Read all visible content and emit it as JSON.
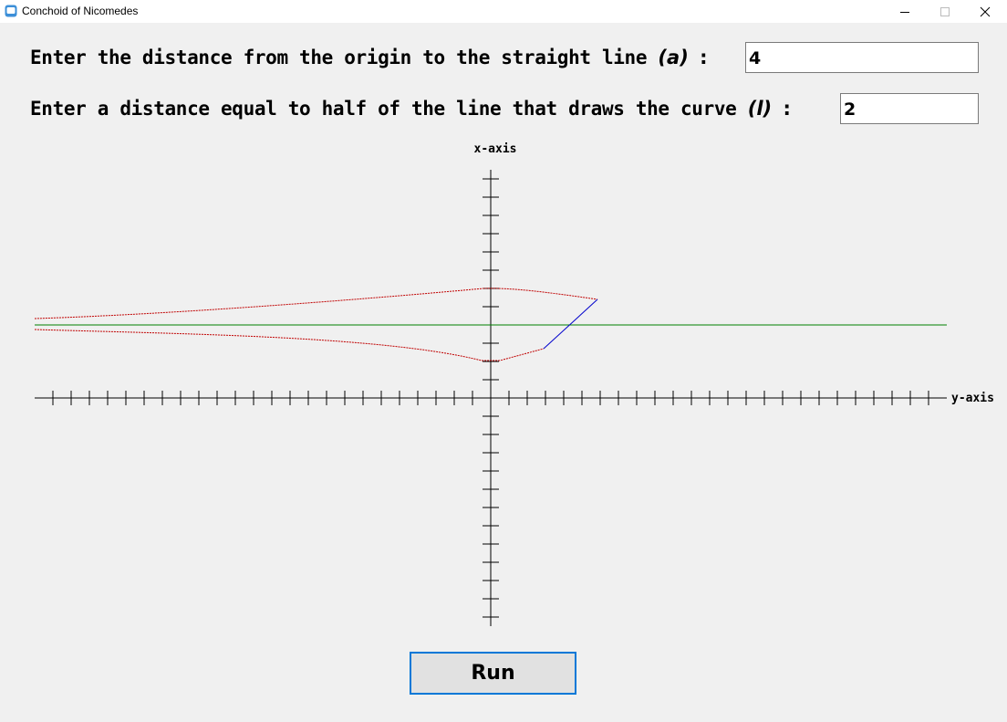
{
  "window": {
    "title": "Conchoid of Nicomedes",
    "icon": "app-icon",
    "controls": [
      "minimize-icon",
      "maximize-icon",
      "close-icon"
    ]
  },
  "form": {
    "label_a": "Enter the distance from the origin to the straight line",
    "var_a": "(a)",
    "colon": ":",
    "value_a": "4",
    "label_l": "Enter a distance equal to half of the line that draws the curve",
    "var_l": "(l)",
    "value_l": "2"
  },
  "plot": {
    "x_axis_label": "x-axis",
    "y_axis_label": "y-axis",
    "colors": {
      "axes": "#000000",
      "curve": "#c00000",
      "baseline": "#008000",
      "segment": "#0000cc"
    }
  },
  "actions": {
    "run_label": "Run"
  }
}
